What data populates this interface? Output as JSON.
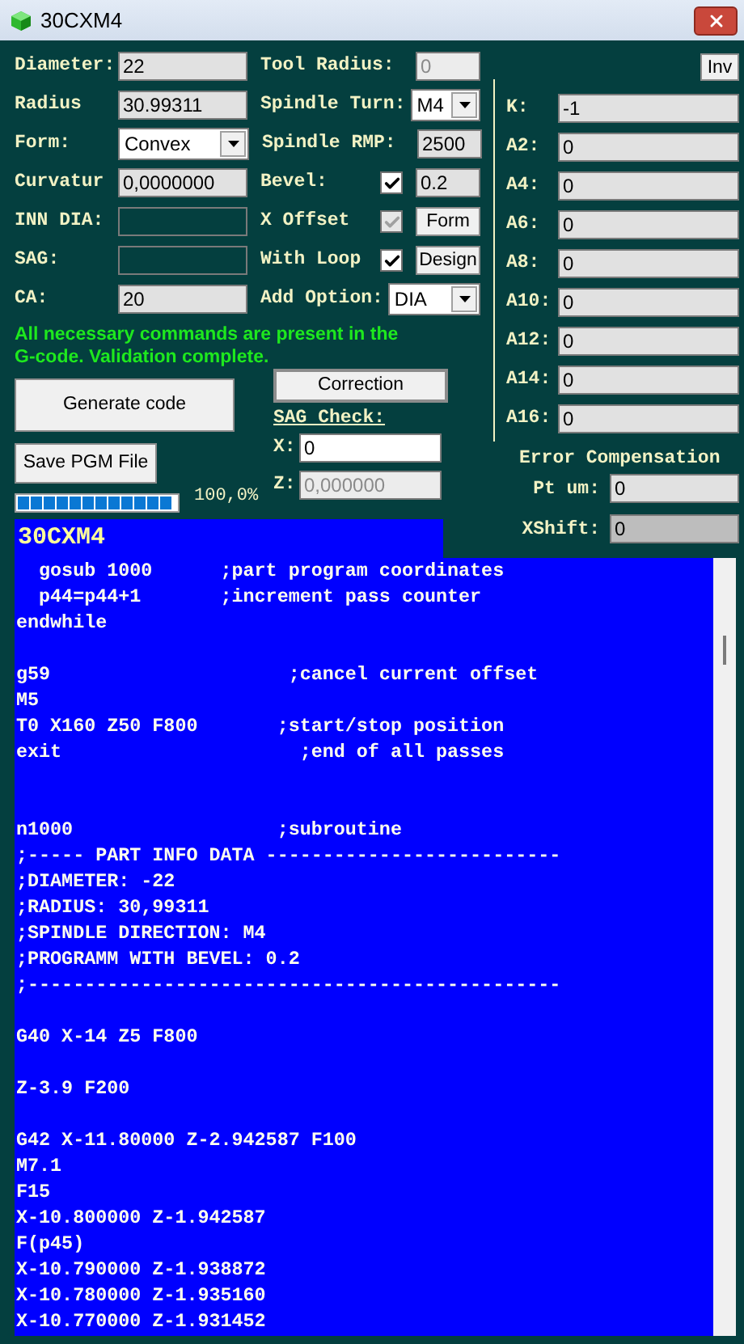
{
  "window": {
    "title": "30CXM4"
  },
  "form": {
    "rows": [
      {
        "left": {
          "label": "Diameter:",
          "value": "22",
          "kind": "field"
        },
        "right": {
          "label": "Tool Radius:",
          "control": {
            "kind": "field",
            "value": "0",
            "disabled": true
          }
        }
      },
      {
        "left": {
          "label": "Radius",
          "value": "30.99311",
          "kind": "field"
        },
        "right": {
          "label": "Spindle Turn:",
          "control": {
            "kind": "select",
            "value": "M4"
          }
        }
      },
      {
        "left": {
          "label": "Form:",
          "value": "Convex",
          "kind": "select"
        },
        "right": {
          "label": "Spindle RMP:",
          "control": {
            "kind": "field",
            "value": "2500"
          }
        }
      },
      {
        "left": {
          "label": "Curvatur",
          "value": "0,0000000",
          "kind": "field"
        },
        "right": {
          "label": "Bevel:",
          "check": {
            "checked": true,
            "disabled": false
          },
          "control": {
            "kind": "field",
            "value": "0.2"
          }
        }
      },
      {
        "left": {
          "label": "INN DIA:",
          "kind": "field",
          "disabled": true
        },
        "right": {
          "label": "X Offset",
          "check": {
            "checked": true,
            "disabled": true
          },
          "control": {
            "kind": "button",
            "value": "Form"
          }
        }
      },
      {
        "left": {
          "label": "SAG:",
          "kind": "field",
          "disabled": true
        },
        "right": {
          "label": "With Loop",
          "check": {
            "checked": true,
            "disabled": false
          },
          "control": {
            "kind": "button",
            "value": "Design"
          }
        }
      },
      {
        "left": {
          "label": "CA:",
          "value": "20",
          "kind": "field"
        },
        "right": {
          "label": "Add Option:",
          "control": {
            "kind": "select",
            "value": "DIA"
          }
        }
      }
    ]
  },
  "status_message": "All necessary commands are present in the G-code. Validation complete.",
  "buttons": {
    "generate": "Generate code",
    "save": "Save PGM File",
    "correction": "Correction"
  },
  "sag_check": {
    "title": "SAG Check:",
    "fields": [
      {
        "label": "X:",
        "value": "0"
      },
      {
        "label": "Z:",
        "value": "0,000000",
        "disabled": true
      }
    ]
  },
  "progress": {
    "level": 1.0,
    "reading": "100,0%"
  },
  "coefficients_panel": {
    "inv_button": "Inv",
    "rows": [
      {
        "label": "K:",
        "value": "-1"
      },
      {
        "label": "A2:",
        "value": "0"
      },
      {
        "label": "A4:",
        "value": "0"
      },
      {
        "label": "A6:",
        "value": "0"
      },
      {
        "label": "A8:",
        "value": "0"
      },
      {
        "label": "A10:",
        "value": "0"
      },
      {
        "label": "A12:",
        "value": "0"
      },
      {
        "label": "A14:",
        "value": "0"
      },
      {
        "label": "A16:",
        "value": "0"
      }
    ]
  },
  "error_compensation": {
    "title": "Error Compensation",
    "fields": [
      {
        "label": "Pt um:",
        "value": "0",
        "readonly": false
      },
      {
        "label": "XShift:",
        "value": "0",
        "readonly": true
      }
    ]
  },
  "code_view": {
    "title": "30CXM4",
    "lines": [
      {
        "kind": "text",
        "text": "  gosub 1000      ;part program coordinates"
      },
      {
        "kind": "text",
        "text": "  p44=p44+1       ;increment pass counter"
      },
      {
        "kind": "text",
        "text": "endwhile"
      },
      {
        "kind": "blank"
      },
      {
        "kind": "text",
        "text": "g59                     ;cancel current offset"
      },
      {
        "kind": "text",
        "text": "M5"
      },
      {
        "kind": "text",
        "text": "T0 X160 Z50 F800       ;start/stop position"
      },
      {
        "kind": "text",
        "text": "exit                     ;end of all passes"
      },
      {
        "kind": "blank"
      },
      {
        "kind": "blank"
      },
      {
        "kind": "text",
        "text": "n1000                  ;subroutine"
      },
      {
        "kind": "text",
        "text": ";----- PART INFO DATA --------------------------"
      },
      {
        "kind": "text",
        "text": ";DIAMETER: -22"
      },
      {
        "kind": "text",
        "text": ";RADIUS: 30,99311"
      },
      {
        "kind": "text",
        "text": ";SPINDLE DIRECTION: M4"
      },
      {
        "kind": "text",
        "text": ";PROGRAMM WITH BEVEL: 0.2"
      },
      {
        "kind": "text",
        "text": ";-----------------------------------------------"
      },
      {
        "kind": "blank"
      },
      {
        "kind": "text",
        "text": "G40 X-14 Z5 F800"
      },
      {
        "kind": "blank"
      },
      {
        "kind": "text",
        "text": "Z-3.9 F200"
      },
      {
        "kind": "blank"
      },
      {
        "kind": "text",
        "text": "G42 X-11.80000 Z-2.942587 F100"
      },
      {
        "kind": "text",
        "text": "M7.1"
      },
      {
        "kind": "text",
        "text": "F15"
      },
      {
        "kind": "text",
        "text": "X-10.800000 Z-1.942587"
      },
      {
        "kind": "text",
        "text": "F(p45)"
      },
      {
        "kind": "text",
        "text": "X-10.790000 Z-1.938872"
      },
      {
        "kind": "text",
        "text": "X-10.780000 Z-1.935160"
      },
      {
        "kind": "text",
        "text": "X-10.770000 Z-1.931452"
      }
    ]
  }
}
